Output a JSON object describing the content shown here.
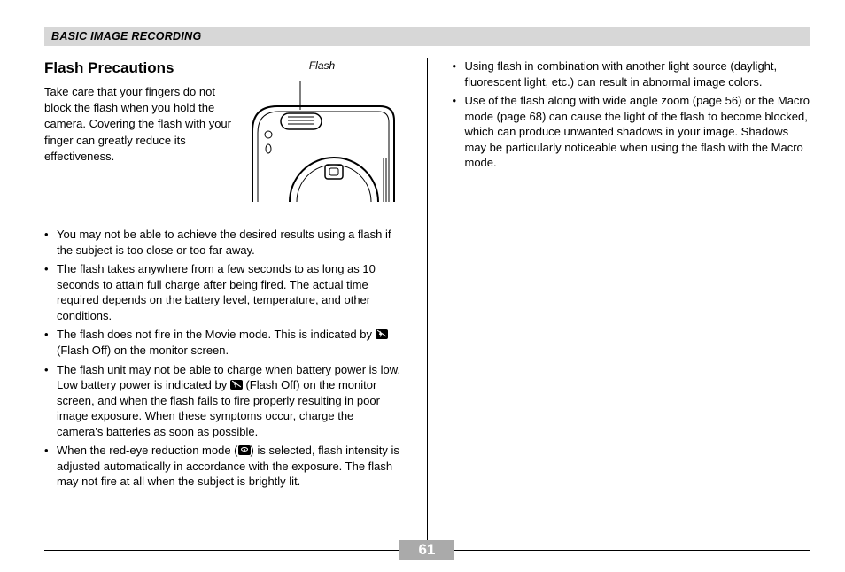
{
  "section_header": "BASIC IMAGE RECORDING",
  "title": "Flash Precautions",
  "diagram_label": "Flash",
  "intro": "Take care that your fingers do not block the flash when you hold the camera. Covering the flash with your finger can greatly reduce its effectiveness.",
  "left_bullets": [
    "You may not be able to achieve the desired results using a flash if the subject is too close or too far away.",
    "The flash takes anywhere from a few seconds to as long as 10 seconds to attain full charge after being fired. The actual time required depends on the battery level, temperature, and other conditions."
  ],
  "left_bullet_flashoff_pre": "The flash does not fire in the Movie mode. This is indicated by ",
  "left_bullet_flashoff_post": " (Flash Off) on the monitor screen.",
  "left_bullet_lowbatt_pre": "The flash unit may not be able to charge when battery power is low. Low battery power is indicated by ",
  "left_bullet_lowbatt_post": " (Flash Off) on the monitor screen, and when the flash fails to fire properly resulting in poor image exposure. When these symptoms occur, charge the camera's batteries as soon as possible.",
  "left_bullet_redeye_pre": "When the red-eye reduction mode (",
  "left_bullet_redeye_post": ") is selected, flash intensity is adjusted automatically in accordance with the exposure. The flash may not fire at all when the subject is brightly lit.",
  "right_bullets": [
    "Using flash in combination with another light source (daylight, fluorescent light, etc.) can result in abnormal image colors.",
    "Use of the flash along with wide angle zoom (page 56) or the Macro mode (page 68) can cause the light of the flash to become blocked, which can produce unwanted shadows in your image. Shadows may be particularly noticeable when using the flash with the Macro mode."
  ],
  "page_number": "61"
}
